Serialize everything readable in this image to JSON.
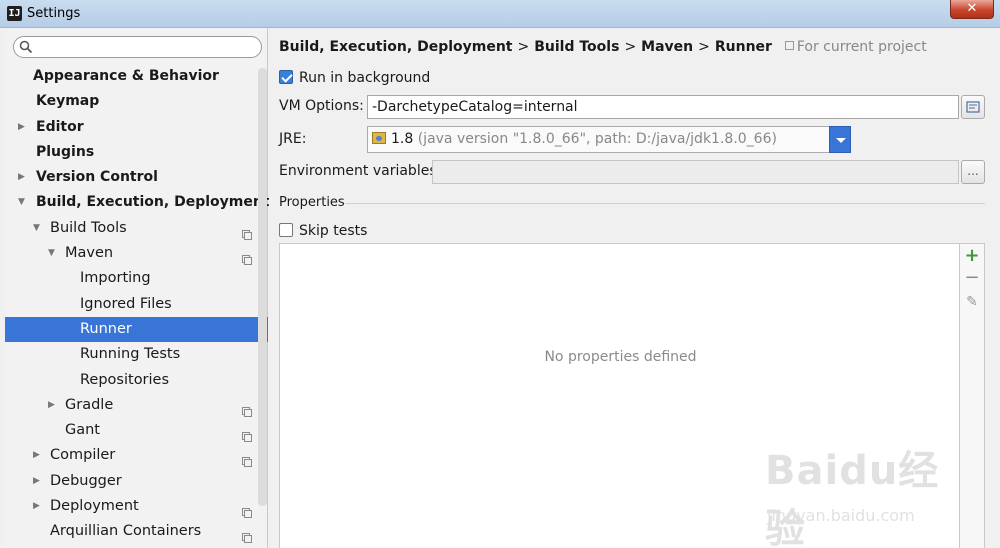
{
  "window": {
    "title": "Settings",
    "app_icon": "IJ",
    "close_label": "✕"
  },
  "search": {
    "placeholder": "",
    "icon": "search-icon"
  },
  "tree": [
    {
      "label": "Appearance & Behavior",
      "bold": true,
      "level": 0,
      "arrow": "",
      "proj": false
    },
    {
      "label": "Keymap",
      "bold": true,
      "level": 0,
      "arrow": "",
      "proj": false
    },
    {
      "label": "Editor",
      "bold": true,
      "level": 0,
      "arrow": "right",
      "proj": false
    },
    {
      "label": "Plugins",
      "bold": true,
      "level": 0,
      "arrow": "",
      "proj": false
    },
    {
      "label": "Version Control",
      "bold": true,
      "level": 0,
      "arrow": "right",
      "proj": false
    },
    {
      "label": "Build, Execution, Deployment",
      "bold": true,
      "level": 0,
      "arrow": "down",
      "proj": false
    },
    {
      "label": "Build Tools",
      "bold": false,
      "level": 1,
      "arrow": "down",
      "proj": true
    },
    {
      "label": "Maven",
      "bold": false,
      "level": 2,
      "arrow": "down",
      "proj": true
    },
    {
      "label": "Importing",
      "bold": false,
      "level": 3,
      "arrow": "",
      "proj": false
    },
    {
      "label": "Ignored Files",
      "bold": false,
      "level": 3,
      "arrow": "",
      "proj": false
    },
    {
      "label": "Runner",
      "bold": false,
      "level": 3,
      "arrow": "",
      "proj": false,
      "selected": true
    },
    {
      "label": "Running Tests",
      "bold": false,
      "level": 3,
      "arrow": "",
      "proj": false
    },
    {
      "label": "Repositories",
      "bold": false,
      "level": 3,
      "arrow": "",
      "proj": false
    },
    {
      "label": "Gradle",
      "bold": false,
      "level": 2,
      "arrow": "right",
      "proj": true
    },
    {
      "label": "Gant",
      "bold": false,
      "level": 2,
      "arrow": "",
      "proj": true
    },
    {
      "label": "Compiler",
      "bold": false,
      "level": 1,
      "arrow": "right",
      "proj": true
    },
    {
      "label": "Debugger",
      "bold": false,
      "level": 1,
      "arrow": "right",
      "proj": false
    },
    {
      "label": "Deployment",
      "bold": false,
      "level": 1,
      "arrow": "right",
      "proj": true
    },
    {
      "label": "Arquillian Containers",
      "bold": false,
      "level": 1,
      "arrow": "",
      "proj": true
    }
  ],
  "breadcrumb": {
    "items": [
      "Build, Execution, Deployment",
      "Build Tools",
      "Maven",
      "Runner"
    ],
    "separator": ">",
    "scope": "For current project"
  },
  "form": {
    "run_in_background": {
      "label": "Run in background",
      "checked": true
    },
    "vm_options": {
      "label": "VM Options:",
      "value": "-DarchetypeCatalog=internal"
    },
    "jre": {
      "label": "JRE:",
      "version": "1.8",
      "detail": "(java version \"1.8.0_66\", path: D:/java/jdk1.8.0_66)"
    },
    "env_vars": {
      "label": "Environment variables:",
      "value": "",
      "browse_label": "..."
    },
    "properties_section": "Properties",
    "skip_tests": {
      "label": "Skip tests",
      "checked": false
    },
    "properties_empty": "No properties defined"
  },
  "toolbar": {
    "add": "+",
    "remove": "−",
    "edit": "✎"
  },
  "watermark": {
    "main": "Baidu经验",
    "sub": "jingyan.baidu.com"
  },
  "colors": {
    "selection": "#3875d7",
    "add_green": "#3c9a3c"
  }
}
